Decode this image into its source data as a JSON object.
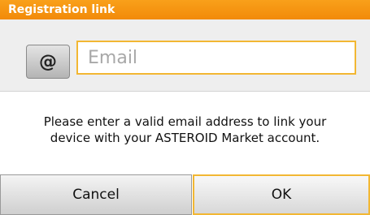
{
  "dialog": {
    "title": "Registration link",
    "email": {
      "icon_label": "@",
      "placeholder": "Email",
      "value": ""
    },
    "message_line1": "Please enter a valid email address to link your",
    "message_line2": "device with your ASTEROID Market account.",
    "buttons": {
      "cancel_label": "Cancel",
      "ok_label": "OK"
    }
  },
  "colors": {
    "title_bar": "#f59512",
    "focus_border": "#f2b733",
    "section_bg": "#eeeeee"
  }
}
